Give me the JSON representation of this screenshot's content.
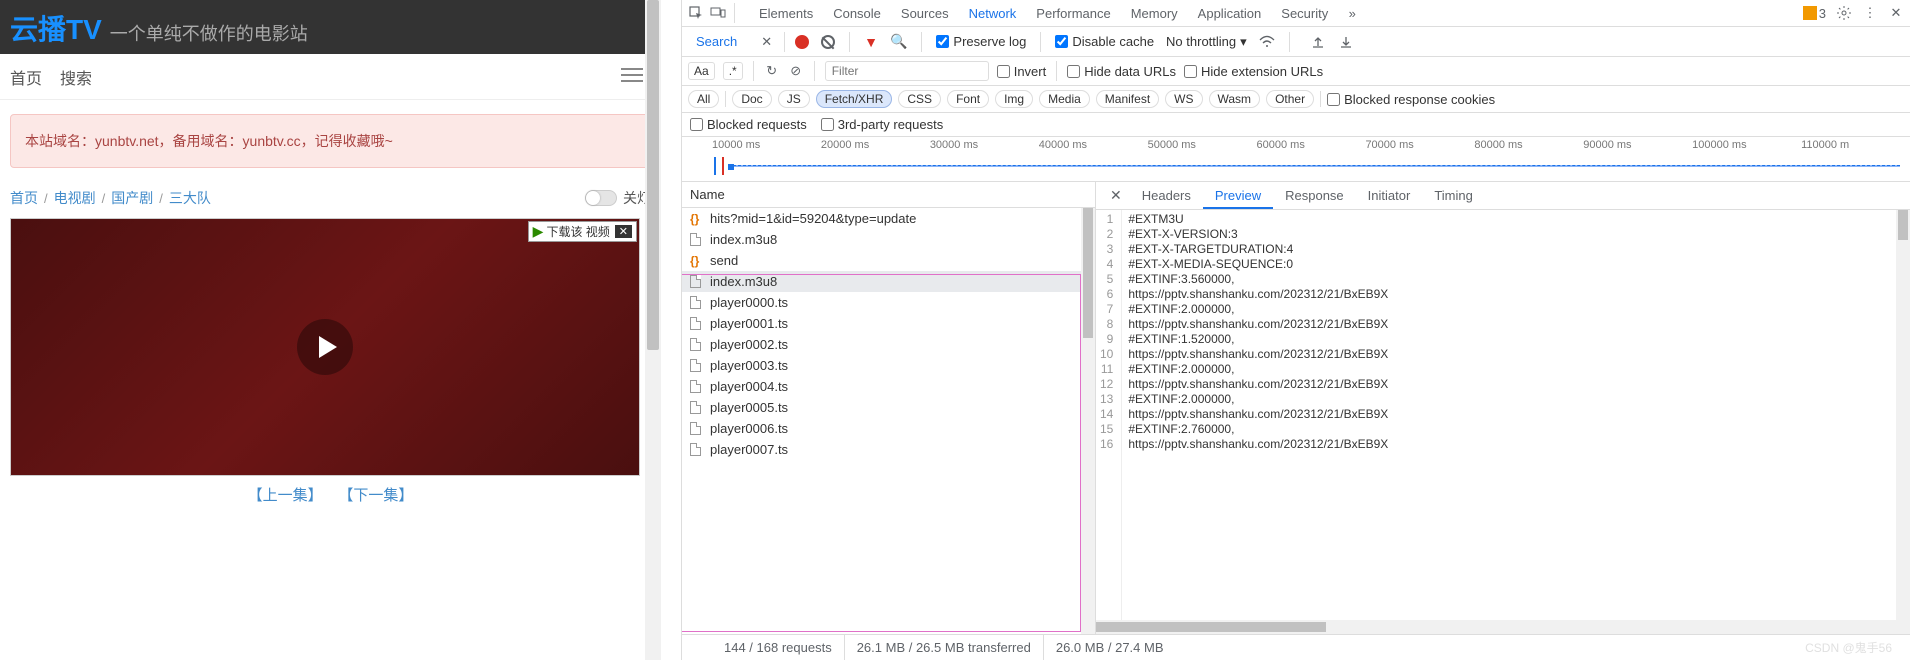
{
  "site": {
    "logo": "云播TV",
    "tagline": "一个单纯不做作的电影站",
    "nav": {
      "home": "首页",
      "search": "搜索"
    },
    "alert": "本站域名：yunbtv.net，备用域名：yunbtv.cc，记得收藏哦~",
    "breadcrumb": [
      "首页",
      "电视剧",
      "国产剧",
      "三大队"
    ],
    "light_toggle": "关灯",
    "download_badge": "下载该 视频",
    "prev_ep": "【上一集】",
    "next_ep": "【下一集】",
    "watermark": "CSDN @鬼手56"
  },
  "devtools": {
    "panels": [
      "Elements",
      "Console",
      "Sources",
      "Network",
      "Performance",
      "Memory",
      "Application",
      "Security"
    ],
    "active_panel": "Network",
    "issues_count": "3",
    "search_tab": "Search",
    "options": {
      "preserve_log": "Preserve log",
      "disable_cache": "Disable cache",
      "throttling": "No throttling",
      "invert": "Invert",
      "hide_data_urls": "Hide data URLs",
      "hide_ext_urls": "Hide extension URLs",
      "blocked_cookies": "Blocked response cookies",
      "blocked_requests": "Blocked requests",
      "third_party": "3rd-party requests"
    },
    "filter_placeholder": "Filter",
    "req_types": [
      "All",
      "Doc",
      "JS",
      "Fetch/XHR",
      "CSS",
      "Font",
      "Img",
      "Media",
      "Manifest",
      "WS",
      "Wasm",
      "Other"
    ],
    "active_req_type": "Fetch/XHR",
    "timeline_ticks": [
      "10000 ms",
      "20000 ms",
      "30000 ms",
      "40000 ms",
      "50000 ms",
      "60000 ms",
      "70000 ms",
      "80000 ms",
      "90000 ms",
      "100000 ms",
      "110000 m"
    ],
    "name_header": "Name",
    "requests": [
      {
        "icon": "brace",
        "name": "hits?mid=1&id=59204&type=update"
      },
      {
        "icon": "doc",
        "name": "index.m3u8"
      },
      {
        "icon": "brace",
        "name": "send"
      },
      {
        "icon": "doc",
        "name": "index.m3u8",
        "selected": true
      },
      {
        "icon": "doc",
        "name": "player0000.ts"
      },
      {
        "icon": "doc",
        "name": "player0001.ts"
      },
      {
        "icon": "doc",
        "name": "player0002.ts"
      },
      {
        "icon": "doc",
        "name": "player0003.ts"
      },
      {
        "icon": "doc",
        "name": "player0004.ts"
      },
      {
        "icon": "doc",
        "name": "player0005.ts"
      },
      {
        "icon": "doc",
        "name": "player0006.ts"
      },
      {
        "icon": "doc",
        "name": "player0007.ts"
      }
    ],
    "preview_tabs": [
      "Headers",
      "Preview",
      "Response",
      "Initiator",
      "Timing"
    ],
    "active_preview_tab": "Preview",
    "preview_lines": [
      "#EXTM3U",
      "#EXT-X-VERSION:3",
      "#EXT-X-TARGETDURATION:4",
      "#EXT-X-MEDIA-SEQUENCE:0",
      "#EXTINF:3.560000,",
      "https://pptv.shanshanku.com/202312/21/BxEB9X",
      "#EXTINF:2.000000,",
      "https://pptv.shanshanku.com/202312/21/BxEB9X",
      "#EXTINF:1.520000,",
      "https://pptv.shanshanku.com/202312/21/BxEB9X",
      "#EXTINF:2.000000,",
      "https://pptv.shanshanku.com/202312/21/BxEB9X",
      "#EXTINF:2.000000,",
      "https://pptv.shanshanku.com/202312/21/BxEB9X",
      "#EXTINF:2.760000,",
      "https://pptv.shanshanku.com/202312/21/BxEB9X"
    ],
    "status": {
      "requests": "144 / 168 requests",
      "transferred": "26.1 MB / 26.5 MB transferred",
      "resources": "26.0 MB / 27.4 MB"
    }
  }
}
